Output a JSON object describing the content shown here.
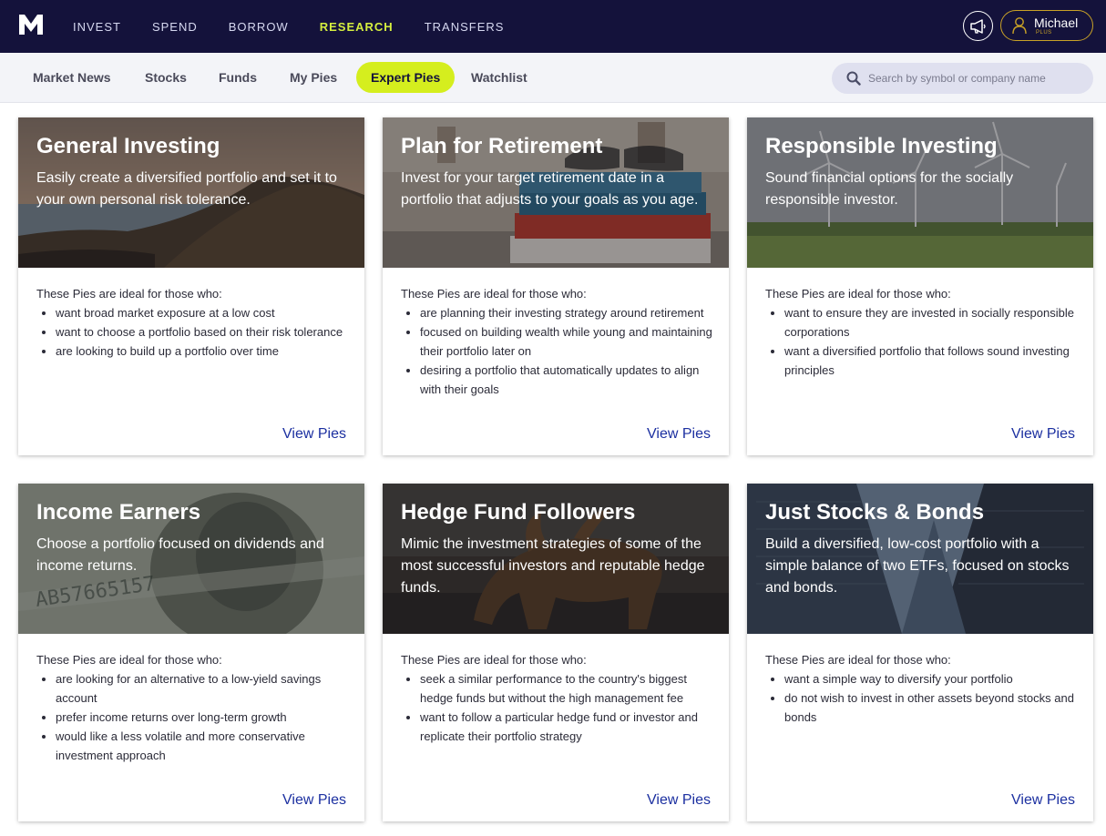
{
  "nav": {
    "items": [
      "INVEST",
      "SPEND",
      "BORROW",
      "RESEARCH",
      "TRANSFERS"
    ],
    "active": "RESEARCH",
    "user_name": "Michael",
    "user_tier": "PLUS"
  },
  "subnav": {
    "tabs": [
      "Market News",
      "Stocks",
      "Funds",
      "My Pies",
      "Expert Pies",
      "Watchlist"
    ],
    "active": "Expert Pies",
    "search_placeholder": "Search by symbol or company name"
  },
  "cards": [
    {
      "title": "General Investing",
      "description": "Easily create a diversified portfolio and set it to your own personal risk tolerance.",
      "intro": "These Pies are ideal for those who:",
      "bullets": [
        "want broad market exposure at a low cost",
        "want to choose a portfolio based on their risk tolerance",
        "are looking to build up a portfolio over time"
      ],
      "cta": "View Pies"
    },
    {
      "title": "Plan for Retirement",
      "description": "Invest for your target retirement date in a portfolio that adjusts to your goals as you age.",
      "intro": "These Pies are ideal for those who:",
      "bullets": [
        "are planning their investing strategy around retirement",
        "focused on building wealth while young and maintaining their portfolio later on",
        "desiring a portfolio that automatically updates to align with their goals"
      ],
      "cta": "View Pies"
    },
    {
      "title": "Responsible Investing",
      "description": "Sound financial options for the socially responsible investor.",
      "intro": "These Pies are ideal for those who:",
      "bullets": [
        "want to ensure they are invested in socially responsible corporations",
        "want a diversified portfolio that follows sound investing principles"
      ],
      "cta": "View Pies"
    },
    {
      "title": "Income Earners",
      "description": "Choose a portfolio focused on dividends and income returns.",
      "intro": "These Pies are ideal for those who:",
      "bullets": [
        "are looking for an alternative to a low-yield savings account",
        "prefer income returns over long-term growth",
        "would like a less volatile and more conservative investment approach"
      ],
      "cta": "View Pies"
    },
    {
      "title": "Hedge Fund Followers",
      "description": "Mimic the investment strategies of some of the most successful investors and reputable hedge funds.",
      "intro": "These Pies are ideal for those who:",
      "bullets": [
        "seek a similar performance to the country's biggest hedge funds but without the high management fee",
        "want to follow a particular hedge fund or investor and replicate their portfolio strategy"
      ],
      "cta": "View Pies"
    },
    {
      "title": "Just Stocks & Bonds",
      "description": "Build a diversified, low-cost portfolio with a simple balance of two ETFs, focused on stocks and bonds.",
      "intro": "These Pies are ideal for those who:",
      "bullets": [
        "want a simple way to diversify your portfolio",
        "do not wish to invest in other assets beyond stocks and bonds"
      ],
      "cta": "View Pies"
    }
  ],
  "hero_images": [
    "coastal-cliff-sunset",
    "books-and-glasses",
    "wind-turbines-field",
    "dollar-bill",
    "charging-bull",
    "skyscrapers-looking-up"
  ],
  "colors": {
    "topbar": "#14123b",
    "accent": "#d5ee1e",
    "link": "#1b2fa0",
    "subbar": "#f3f4f8"
  }
}
